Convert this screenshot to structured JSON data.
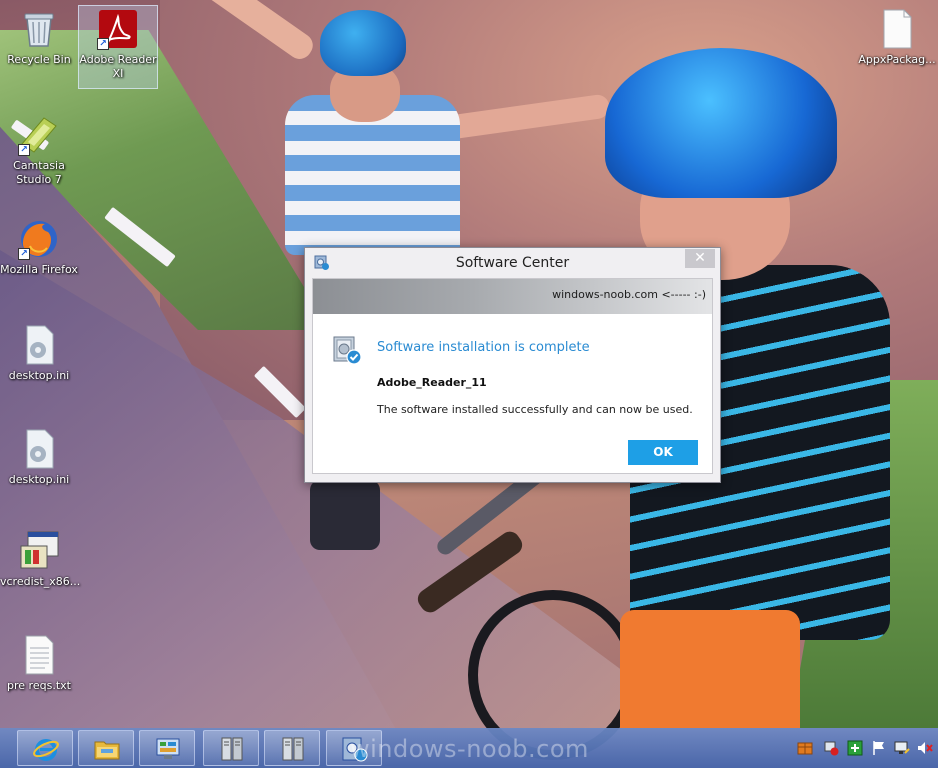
{
  "desktop": {
    "icons": [
      {
        "label": "Recycle Bin",
        "icon": "recycle-bin-icon"
      },
      {
        "label": "Adobe Reader XI",
        "icon": "adobe-reader-icon"
      },
      {
        "label": "Camtasia Studio 7",
        "icon": "camtasia-icon"
      },
      {
        "label": "Mozilla Firefox",
        "icon": "firefox-icon"
      },
      {
        "label": "desktop.ini",
        "icon": "ini-file-icon"
      },
      {
        "label": "desktop.ini",
        "icon": "ini-file-icon"
      },
      {
        "label": "vcredist_x86...",
        "icon": "installer-icon"
      },
      {
        "label": "pre reqs.txt",
        "icon": "text-file-icon"
      },
      {
        "label": "AppxPackag...",
        "icon": "blank-file-icon"
      }
    ]
  },
  "dialog": {
    "title": "Software Center",
    "close_glyph": "✕",
    "banner_text": "windows-noob.com <----- :-)",
    "heading": "Software installation is complete",
    "app_name": "Adobe_Reader_11",
    "message": "The software installed successfully and can now be used.",
    "ok_label": "OK"
  },
  "taskbar": {
    "buttons": [
      {
        "icon": "internet-explorer-icon"
      },
      {
        "icon": "file-explorer-icon"
      },
      {
        "icon": "control-panel-icon"
      },
      {
        "icon": "server-manager-icon"
      },
      {
        "icon": "server-manager-icon"
      },
      {
        "icon": "software-center-icon"
      }
    ],
    "watermark": "windows-noob.com",
    "tray": [
      "package-icon",
      "network-alert-icon",
      "update-icon",
      "action-center-flag-icon",
      "network-icon",
      "volume-muted-icon"
    ]
  },
  "colors": {
    "accent_blue": "#2a8bd2",
    "ok_button": "#1e9fe6",
    "taskbar": "#5a7cc0"
  }
}
